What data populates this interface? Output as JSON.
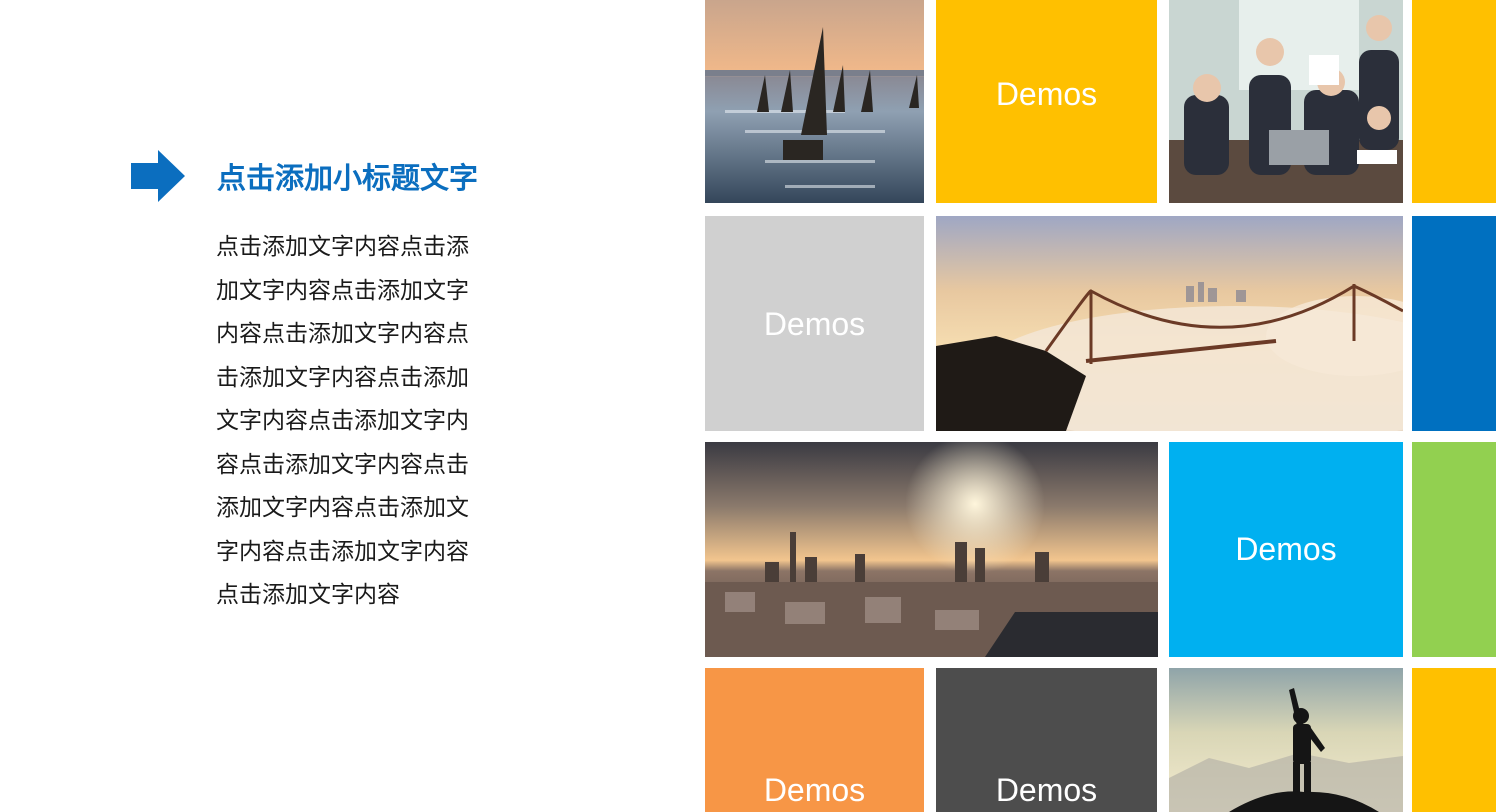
{
  "subtitle": "点击添加小标题文字",
  "body_lines": [
    "点击添加文字内容点击添",
    "加文字内容点击添加文字",
    "内容点击添加文字内容点",
    "击添加文字内容点击添加",
    "文字内容点击添加文字内",
    "容点击添加文字内容点击",
    "添加文字内容点击添加文",
    "字内容点击添加文字内容",
    "点击添加文字内容"
  ],
  "tiles": {
    "yellow_label": "Demos",
    "gray_label": "Demos",
    "blue_label": "Demos",
    "orange_label": "Demos",
    "dark_label": "Demos"
  },
  "photos": {
    "sailboats": "sailboats-photo",
    "business": "business-meeting-photo",
    "bridge": "bridge-in-clouds-photo",
    "city": "city-skyline-sunset-photo",
    "climber": "summit-silhouette-photo"
  },
  "colors": {
    "accent_blue": "#0b6ebf",
    "yellow": "#ffc000",
    "gray": "#d0d0d0",
    "deep_blue": "#0070c0",
    "sky_blue": "#00b0f0",
    "green": "#92d050",
    "orange": "#f79646",
    "dark_gray": "#4d4d4d"
  }
}
